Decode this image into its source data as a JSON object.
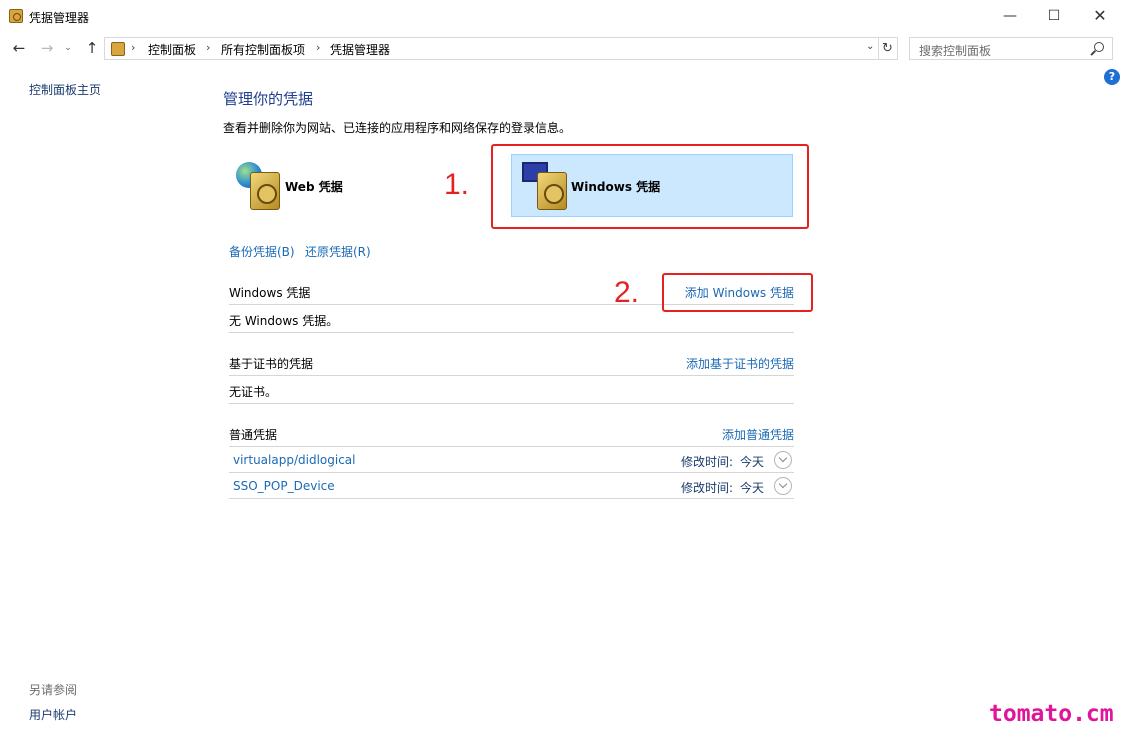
{
  "window": {
    "title": "凭据管理器",
    "minimize": "—",
    "maximize": "☐",
    "close": "✕"
  },
  "nav": {
    "back": "←",
    "forward": "→",
    "recent": "⌄",
    "up": "↑",
    "refresh": "↻"
  },
  "breadcrumb": [
    "控制面板",
    "所有控制面板项",
    "凭据管理器"
  ],
  "search": {
    "placeholder": "搜索控制面板"
  },
  "help": "?",
  "sidebar": {
    "home": "控制面板主页",
    "see_also": "另请参阅",
    "user_accounts": "用户帐户"
  },
  "main": {
    "title": "管理你的凭据",
    "description": "查看并删除你为网站、已连接的应用程序和网络保存的登录信息。",
    "tiles": [
      {
        "label": "Web 凭据",
        "selected": false
      },
      {
        "label": "Windows 凭据",
        "selected": true
      }
    ],
    "backup": "备份凭据(B)",
    "restore": "还原凭据(R)",
    "sections": [
      {
        "title": "Windows 凭据",
        "action": "添加 Windows 凭据",
        "empty": "无 Windows 凭据。"
      },
      {
        "title": "基于证书的凭据",
        "action": "添加基于证书的凭据",
        "empty": "无证书。"
      },
      {
        "title": "普通凭据",
        "action": "添加普通凭据",
        "items": [
          {
            "name": "virtualapp/didlogical",
            "modified_label": "修改时间:",
            "modified": "今天"
          },
          {
            "name": "SSO_POP_Device",
            "modified_label": "修改时间:",
            "modified": "今天"
          }
        ]
      }
    ]
  },
  "annotations": {
    "step1": "1.",
    "step2": "2.",
    "color": "#e52222"
  },
  "watermark": "tomato.cm"
}
